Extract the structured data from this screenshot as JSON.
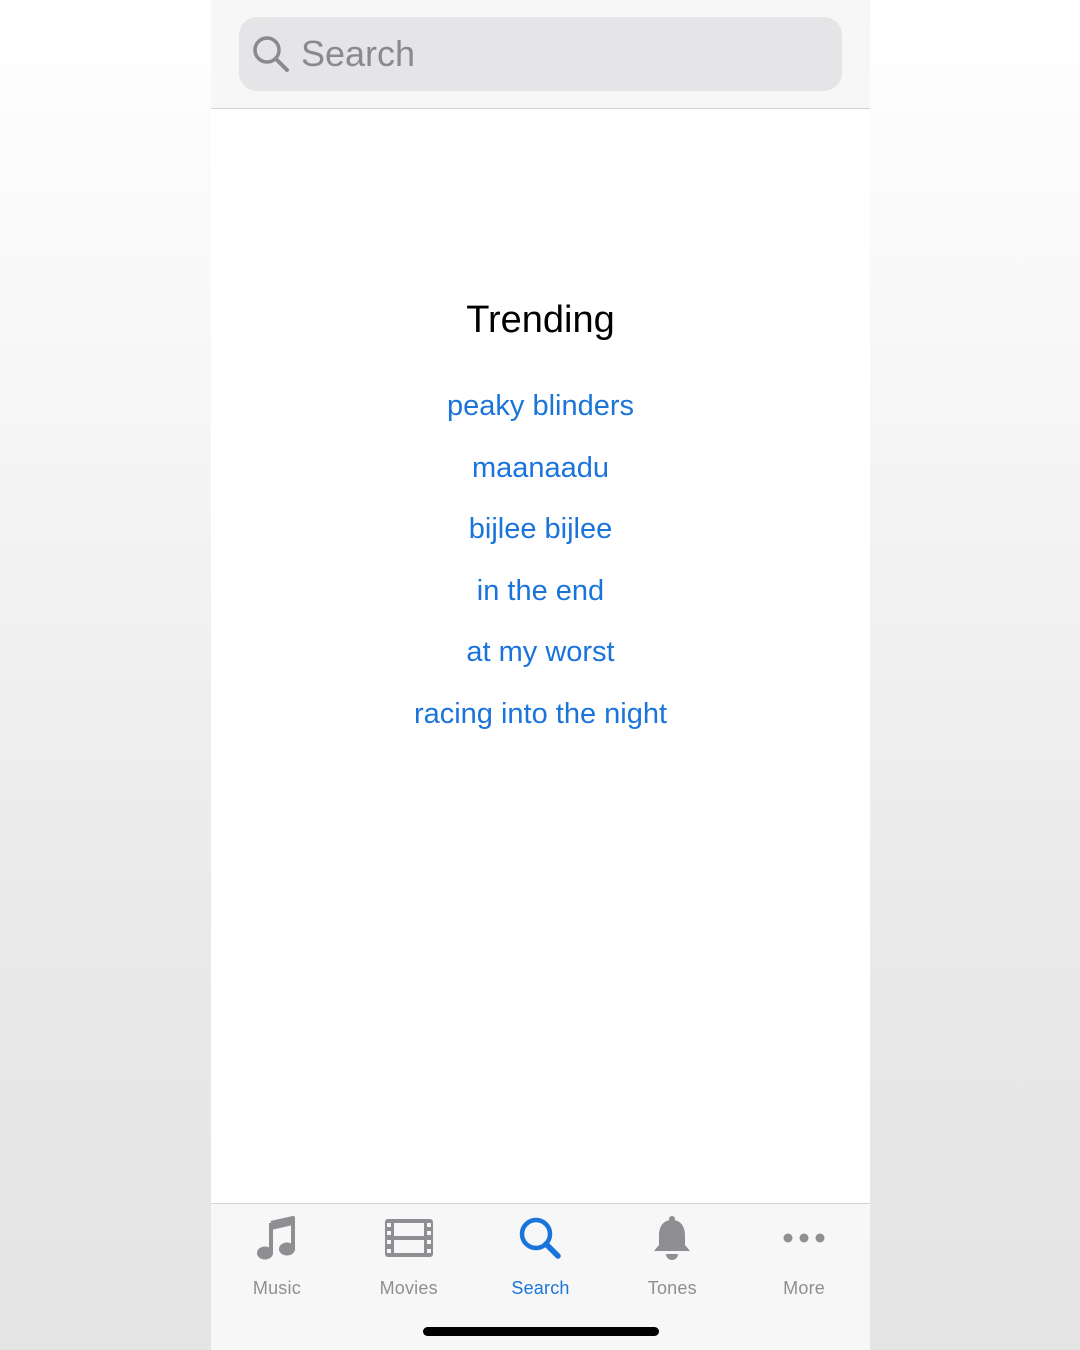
{
  "search": {
    "placeholder": "Search",
    "icon": "magnifying-glass-icon"
  },
  "trending": {
    "title": "Trending",
    "items": [
      "peaky blinders",
      "maanaadu",
      "bijlee bijlee",
      "in the end",
      "at my worst",
      "racing into the night"
    ]
  },
  "tab_bar": {
    "active": "Search",
    "tabs": [
      {
        "label": "Music",
        "icon": "music-note-icon"
      },
      {
        "label": "Movies",
        "icon": "film-strip-icon"
      },
      {
        "label": "Search",
        "icon": "search-icon"
      },
      {
        "label": "Tones",
        "icon": "bell-icon"
      },
      {
        "label": "More",
        "icon": "ellipsis-icon"
      }
    ]
  },
  "colors": {
    "accent": "#1a74d9",
    "inactive": "#8e8e93",
    "search_field": "#e5e5e7",
    "bar_background": "#f7f7f7"
  }
}
